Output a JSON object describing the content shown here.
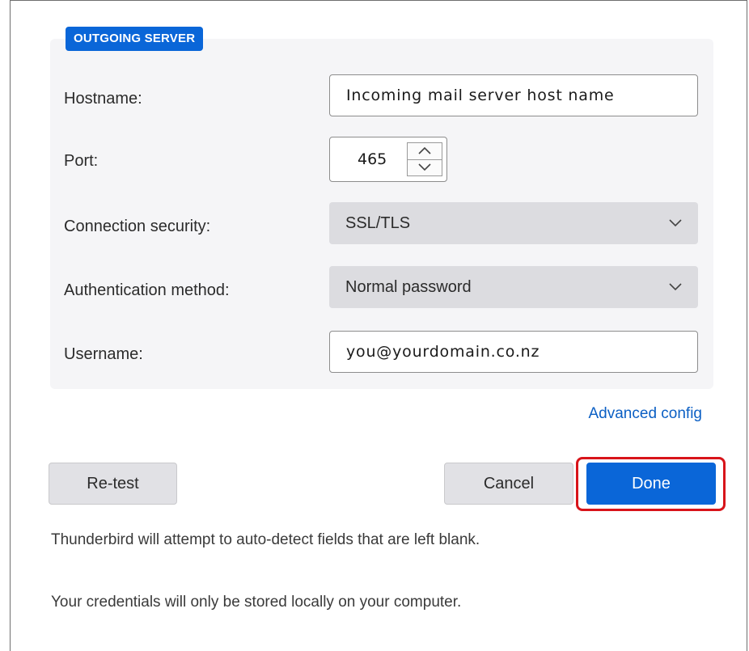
{
  "section": {
    "title": "OUTGOING SERVER"
  },
  "form": {
    "hostname": {
      "label": "Hostname:",
      "value": "Incoming mail server host name"
    },
    "port": {
      "label": "Port:",
      "value": "465"
    },
    "connection_security": {
      "label": "Connection security:",
      "value": "SSL/TLS"
    },
    "authentication_method": {
      "label": "Authentication method:",
      "value": "Normal password"
    },
    "username": {
      "label": "Username:",
      "value": "you@yourdomain.co.nz"
    }
  },
  "links": {
    "advanced_config": "Advanced config"
  },
  "buttons": {
    "retest": "Re-test",
    "cancel": "Cancel",
    "done": "Done"
  },
  "notes": {
    "auto_detect": "Thunderbird will attempt to auto-detect fields that are left blank.",
    "credentials": "Your credentials will only be stored locally on your computer."
  },
  "colors": {
    "accent": "#0a66d8",
    "link": "#0b5fc4",
    "highlight": "#d8141a",
    "panel": "#f5f5f7"
  },
  "icons": {
    "spin_up": "chevron-up-icon",
    "spin_down": "chevron-down-icon",
    "select_arrow": "chevron-down-icon"
  }
}
